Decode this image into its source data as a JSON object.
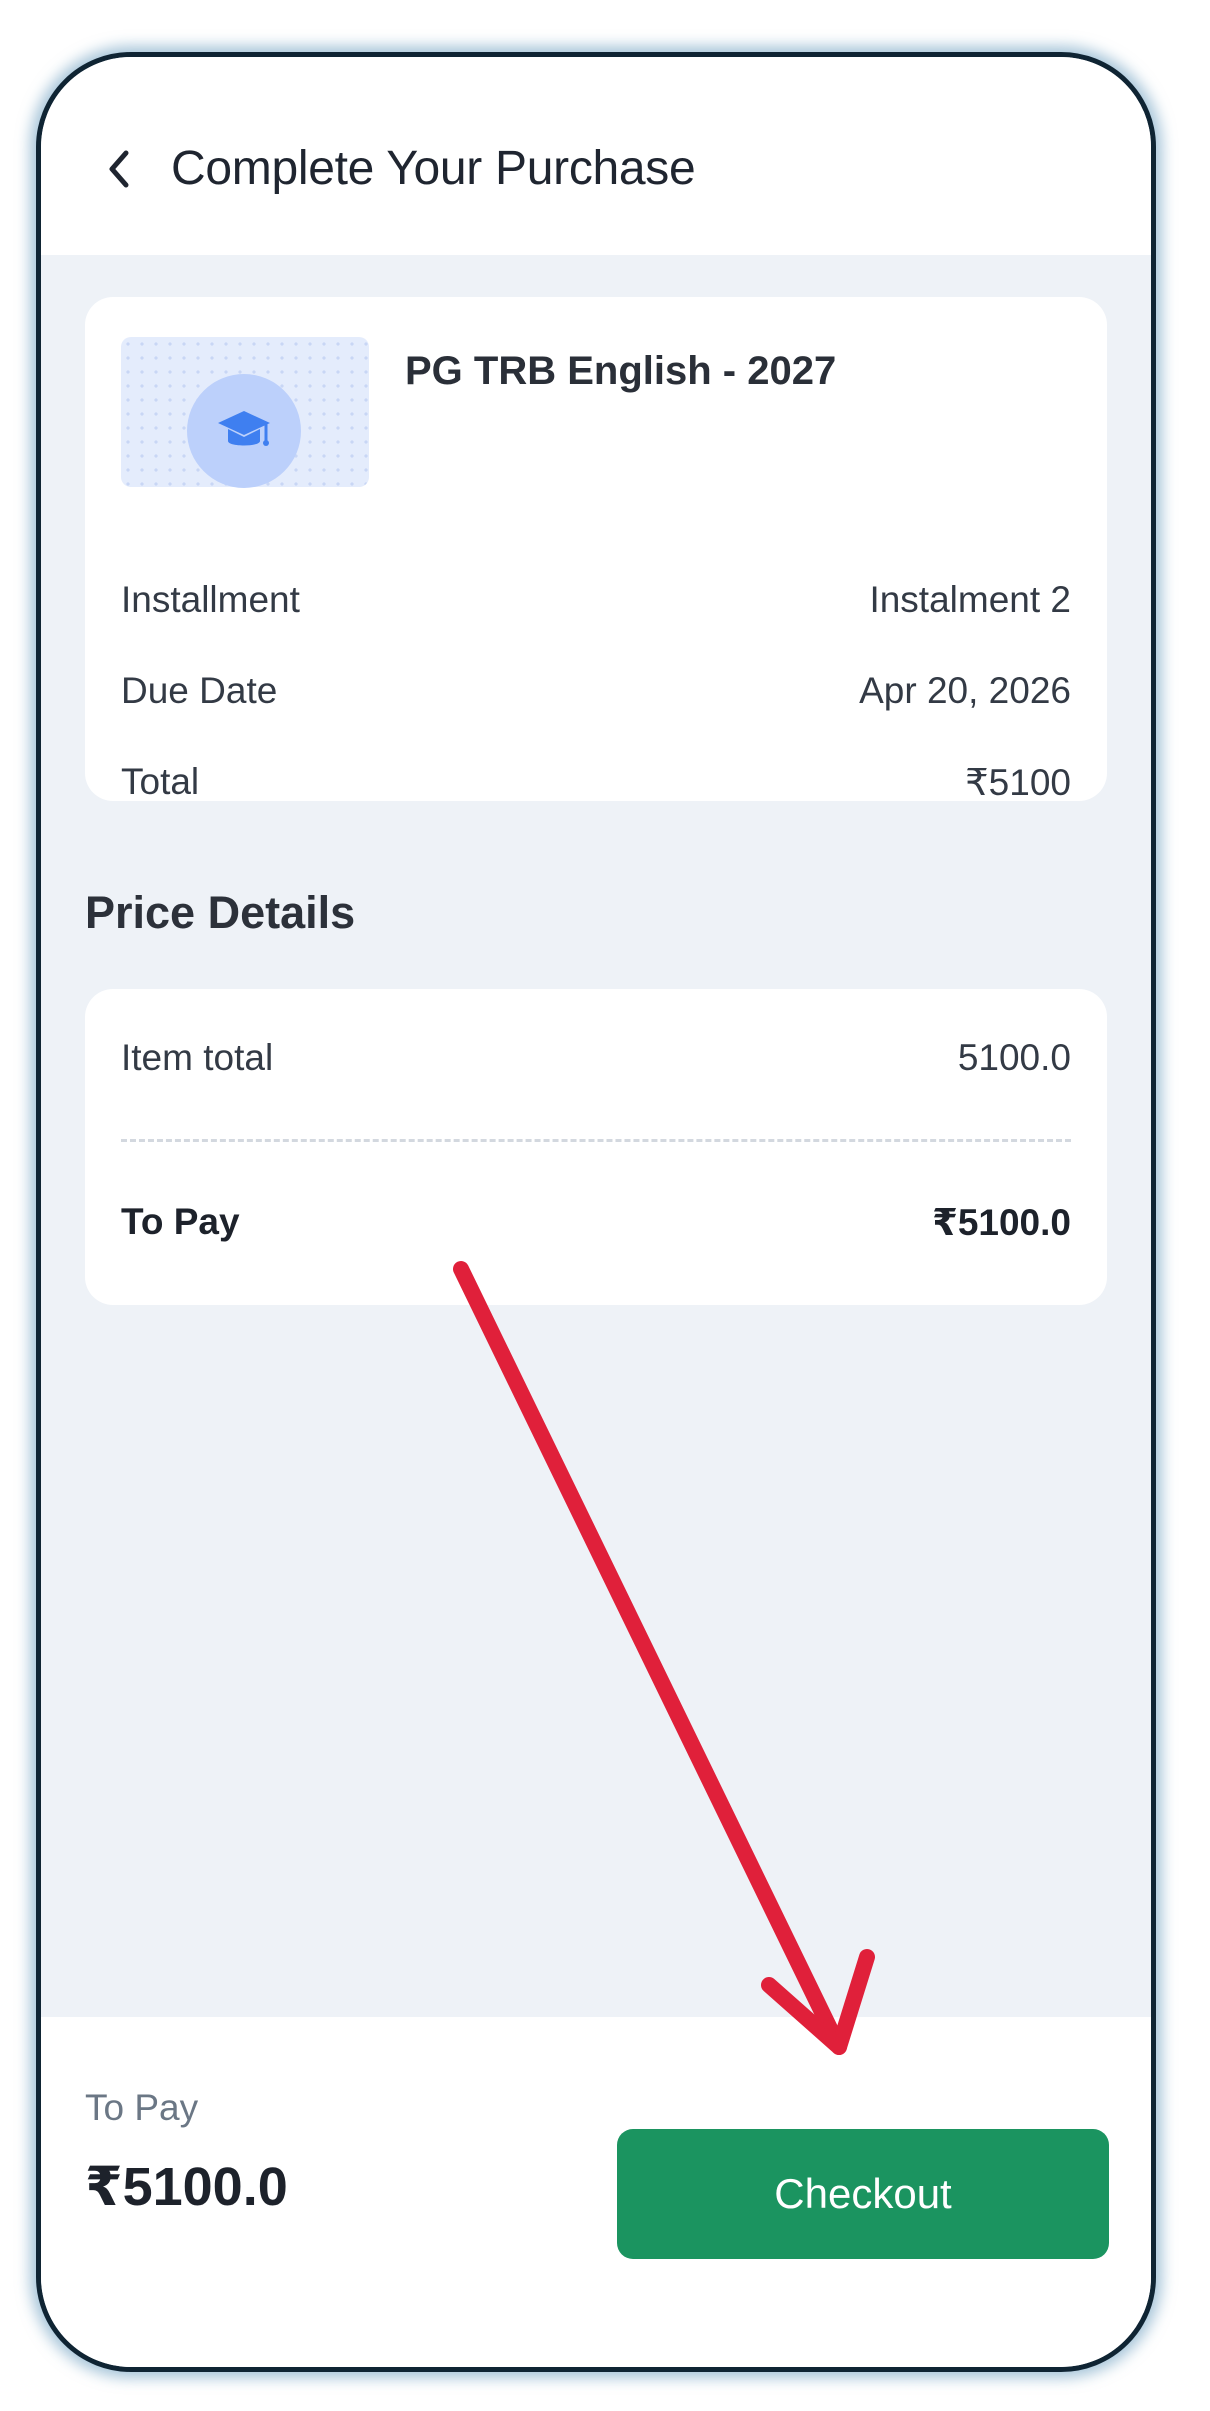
{
  "header": {
    "title": "Complete Your Purchase",
    "back_icon": "chevron-left-icon"
  },
  "course": {
    "title": "PG TRB English - 2027",
    "thumb_icon": "graduation-cap-icon",
    "rows": [
      {
        "label": "Installment",
        "value": "Instalment 2"
      },
      {
        "label": "Due Date",
        "value": "Apr 20, 2026"
      },
      {
        "label": "Total",
        "value": "₹5100"
      }
    ]
  },
  "price_details": {
    "title": "Price Details",
    "item_total_label": "Item total",
    "item_total_value": "5100.0",
    "to_pay_label": "To Pay",
    "to_pay_value": "₹5100.0"
  },
  "bottom_bar": {
    "label": "To Pay",
    "amount": "₹5100.0",
    "checkout_label": "Checkout"
  },
  "colors": {
    "accent_green": "#1b9460",
    "annotation_arrow": "#e0203a",
    "page_background": "#eef2f7"
  }
}
